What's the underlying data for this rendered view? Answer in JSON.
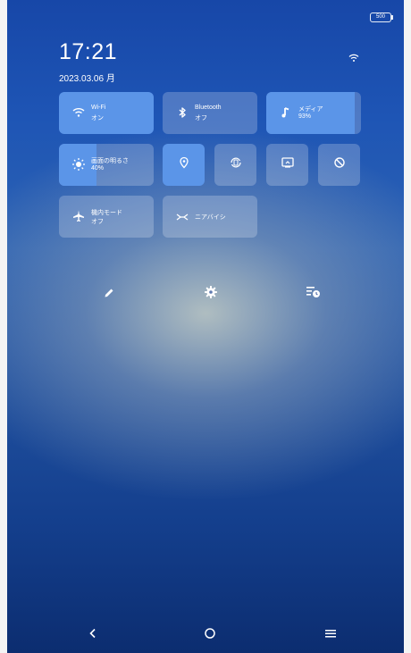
{
  "status": {
    "battery_label": "500"
  },
  "clock": {
    "time": "17:21",
    "date": "2023.03.06 月"
  },
  "tiles": {
    "wifi": {
      "label": "Wi-Fi",
      "state": "オン"
    },
    "bluetooth": {
      "label": "Bluetooth",
      "state": "オフ"
    },
    "media": {
      "label": "メディア",
      "value": "93%",
      "level": 0.93
    },
    "brightness": {
      "label": "画面の明るさ",
      "value": "40%",
      "level": 0.4
    },
    "airplane": {
      "label": "機内モード",
      "state": "オフ"
    },
    "nearby": {
      "label": "ニアバイシ"
    }
  },
  "icons": {
    "location": "location-pin-icon",
    "autorotate": "auto-rotate-icon",
    "screencast": "screen-cast-icon",
    "dnd": "do-not-disturb-icon",
    "edit": "pencil-icon",
    "settings": "gear-icon",
    "notifications": "notification-history-icon"
  },
  "colors": {
    "accent": "#5b95e8",
    "tile_off": "rgba(255,255,255,0.22)"
  }
}
